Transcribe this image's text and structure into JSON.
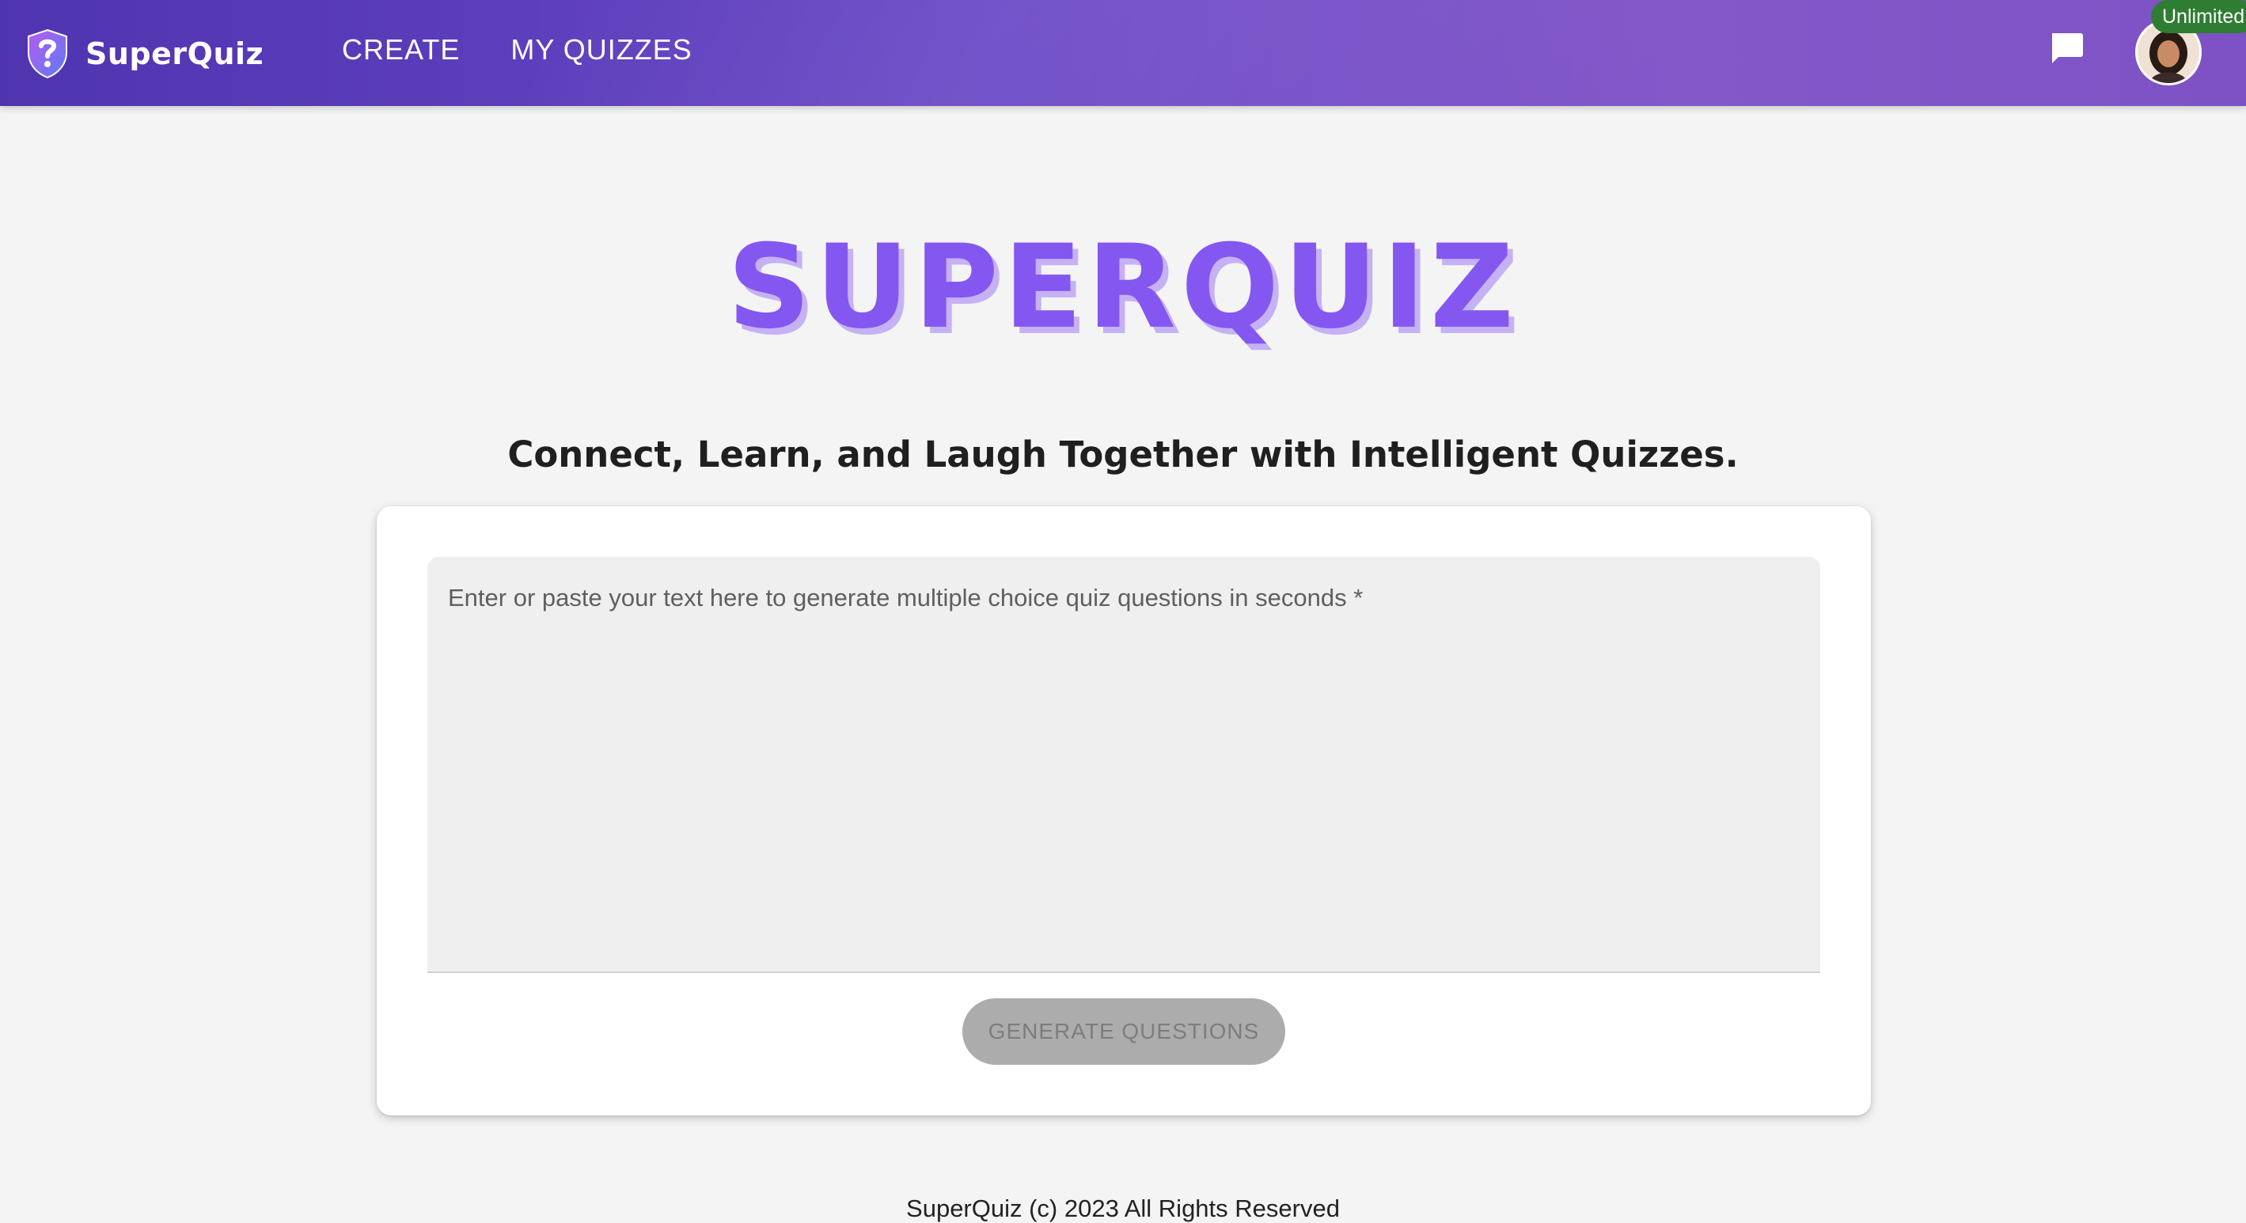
{
  "appbar": {
    "brand": {
      "name": "SuperQuiz",
      "logo_icon": "shield-question-icon"
    },
    "nav": [
      {
        "label": "CREATE"
      },
      {
        "label": "MY QUIZZES"
      }
    ],
    "chat_icon": "chat-icon",
    "user": {
      "plan_badge": "Unlimited",
      "avatar_icon": "user-avatar"
    }
  },
  "hero": {
    "title": "SUPERQUIZ",
    "tagline": "Connect, Learn, and Laugh Together with Intelligent Quizzes."
  },
  "quiz_form": {
    "text_input": {
      "value": "",
      "placeholder": "Enter or paste your text here to generate multiple choice quiz questions in seconds *"
    },
    "generate_label": "GENERATE QUESTIONS"
  },
  "footer": {
    "text": "SuperQuiz (c) 2023 All Rights Reserved"
  },
  "colors": {
    "appbar_start": "#4f34b0",
    "appbar_end": "#8458c9",
    "title_purple": "#8457f0",
    "badge_green": "#2e7d32",
    "page_bg": "#f4f4f4"
  }
}
